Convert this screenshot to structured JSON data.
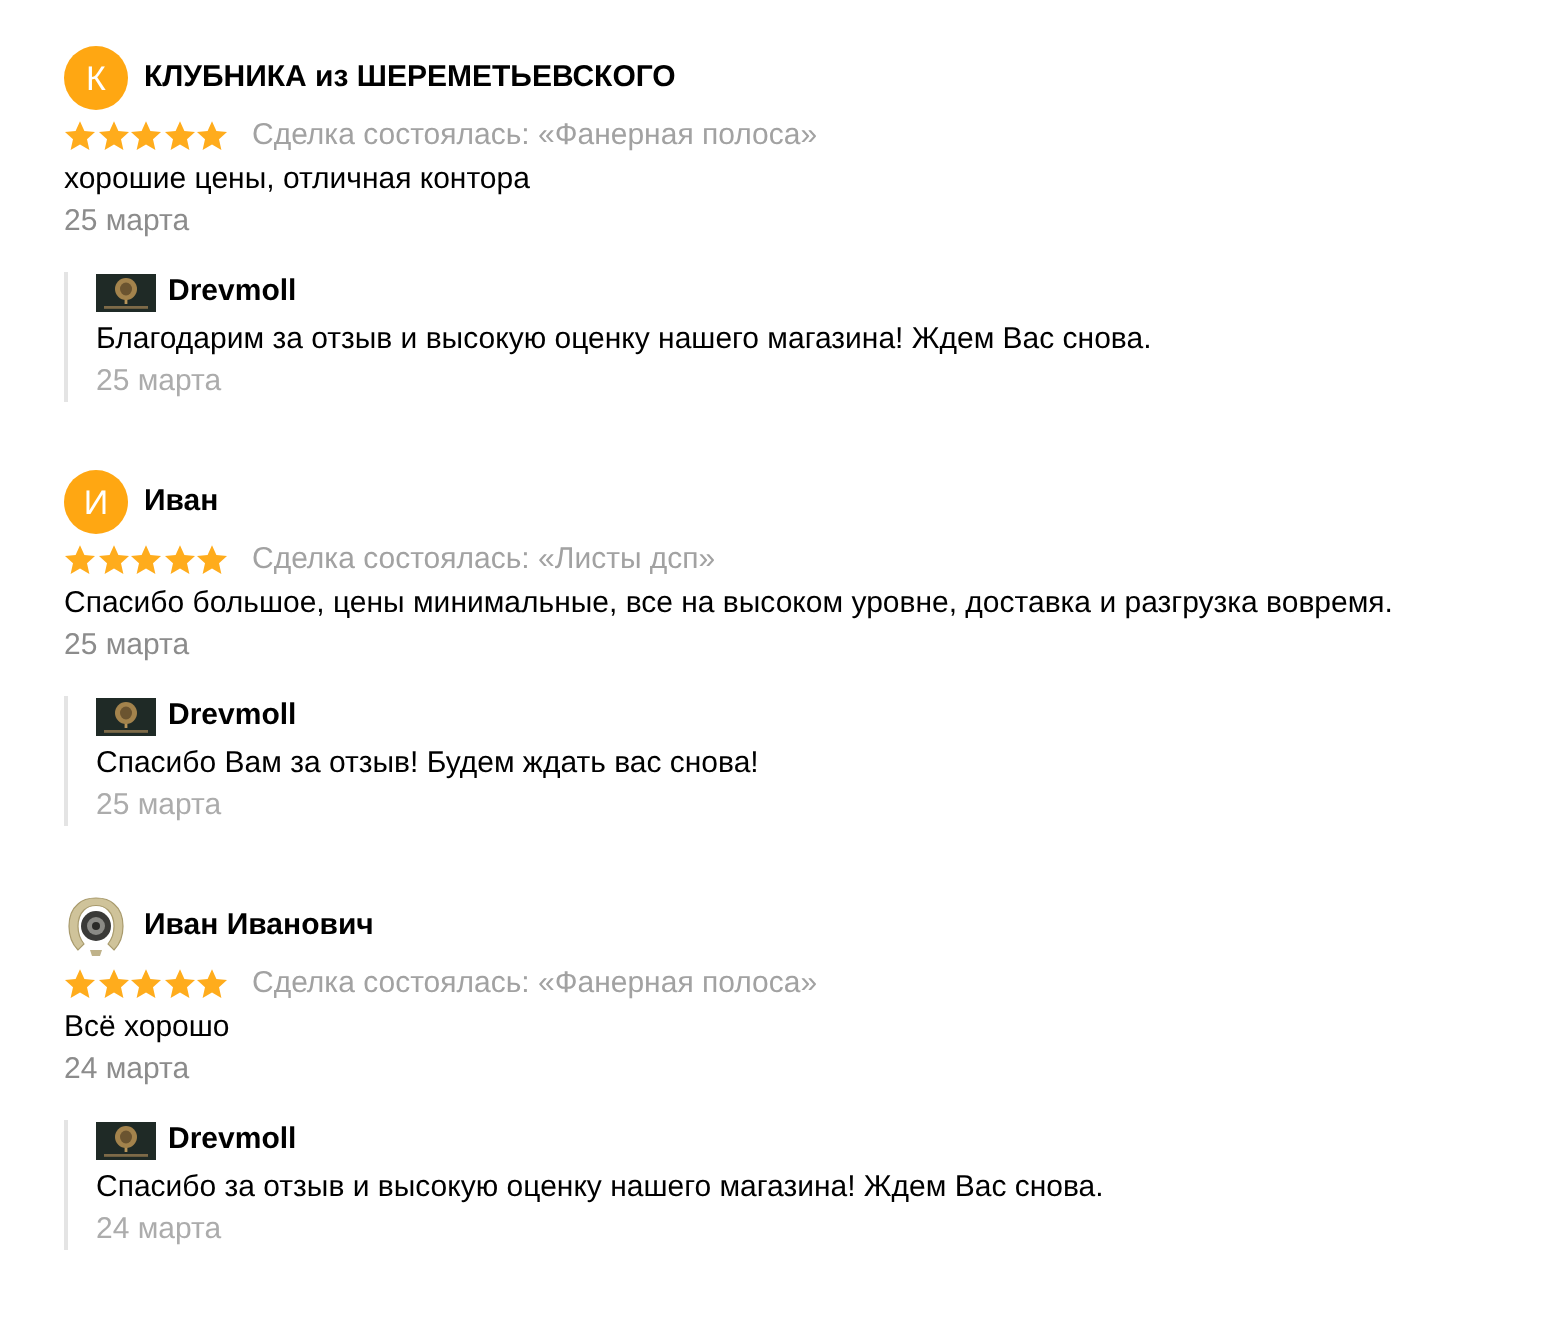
{
  "reviews": [
    {
      "author": {
        "name": "КЛУБНИКА из ШЕРЕМЕТЬЕВСКОГО",
        "avatar": {
          "kind": "letter",
          "letter": "К"
        }
      },
      "stars": 5,
      "deal": "Сделка состоялась: «Фанерная полоса»",
      "text": "хорошие цены, отличная контора",
      "date": "25 марта",
      "reply": {
        "author": "Drevmoll",
        "text": "Благодарим за отзыв и высокую оценку нашего магазина! Ждем Вас снова.",
        "date": "25 марта"
      }
    },
    {
      "author": {
        "name": "Иван",
        "avatar": {
          "kind": "letter",
          "letter": "И"
        }
      },
      "stars": 5,
      "deal": "Сделка состоялась: «Листы дсп»",
      "text": "Спасибо большое, цены минимальные, все на высоком уровне, доставка и разгрузка вовремя.",
      "date": "25 марта",
      "reply": {
        "author": "Drevmoll",
        "text": "Спасибо Вам за отзыв! Будем ждать вас снова!",
        "date": "25 марта"
      }
    },
    {
      "author": {
        "name": "Иван Иванович",
        "avatar": {
          "kind": "image"
        }
      },
      "stars": 5,
      "deal": "Сделка состоялась: «Фанерная полоса»",
      "text": "Всё хорошо",
      "date": "24 марта",
      "reply": {
        "author": "Drevmoll",
        "text": "Спасибо за отзыв и высокую оценку нашего магазина! Ждем Вас снова.",
        "date": "24 марта"
      }
    }
  ]
}
